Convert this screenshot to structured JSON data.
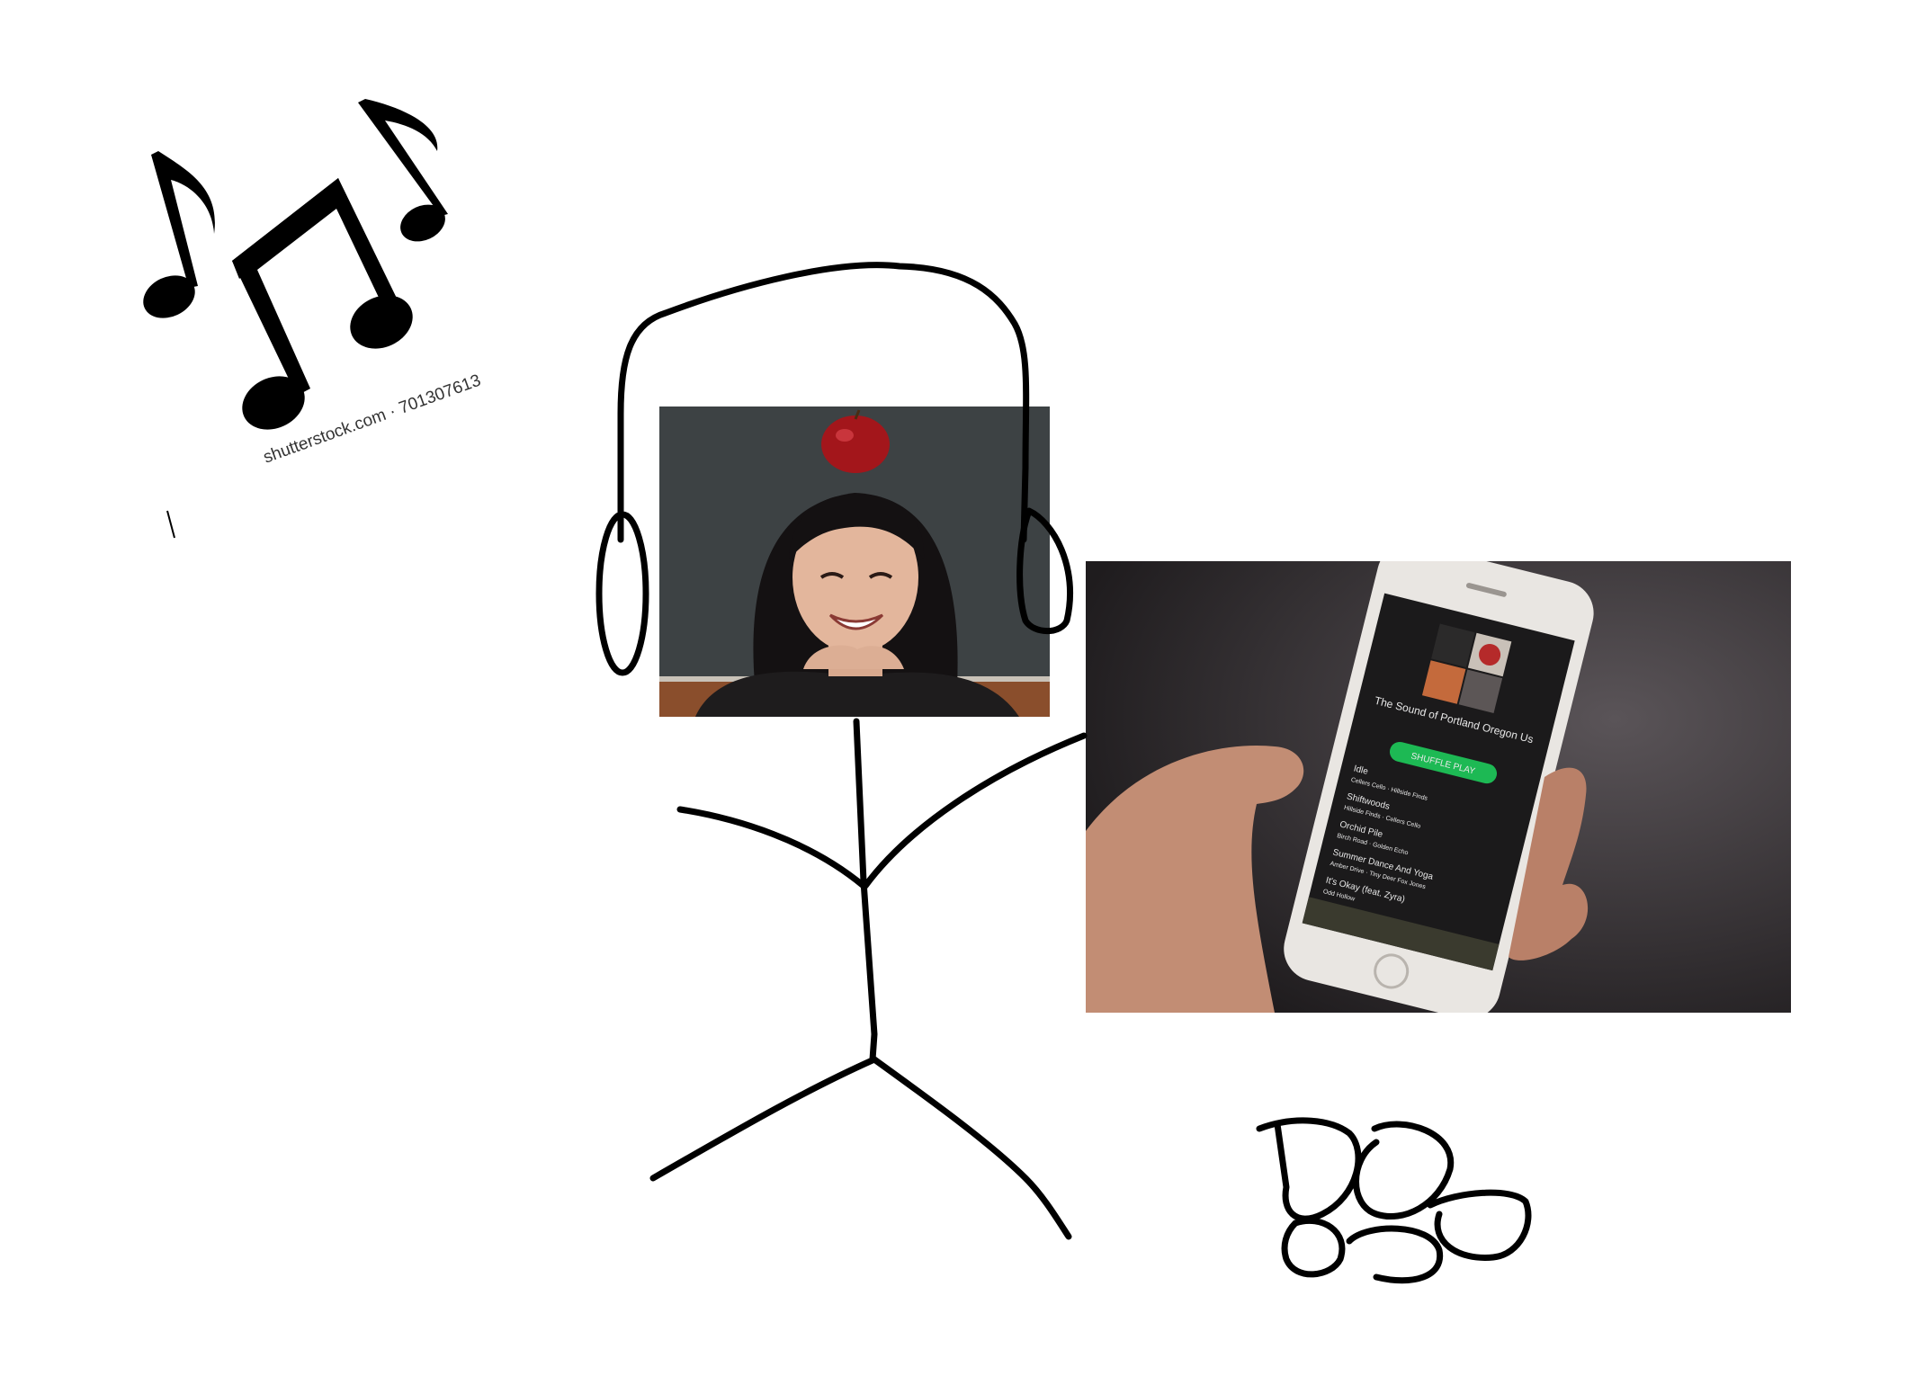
{
  "canvas": {
    "background": "#ffffff"
  },
  "watermark": {
    "text": "shutterstock.com · 701307613"
  },
  "icons": {
    "music_notes": "music-notes-icon",
    "signature": "signature-scribble"
  },
  "portrait": {
    "alt": "Smiling person with an apple balanced on her head"
  },
  "phone_photo": {
    "alt": "Hand holding a smartphone showing a music playlist app",
    "playlist_title": "The Sound of Portland Oregon Us",
    "shuffle_label": "SHUFFLE PLAY",
    "accent": "#1db954",
    "tracks": [
      {
        "title": "Idle",
        "artist": "Cellers Cello · Hillside Finds"
      },
      {
        "title": "Shiftwoods",
        "artist": "Hillside Finds · Cellers Cello"
      },
      {
        "title": "Orchid Pile",
        "artist": "Birch Road · Golden Echo"
      },
      {
        "title": "Summer Dance And Yoga",
        "artist": "Amber Drive · Tiny Deer Fox Jones"
      },
      {
        "title": "It's Okay (feat. Zyra)",
        "artist": "Odd Hollow"
      }
    ]
  }
}
